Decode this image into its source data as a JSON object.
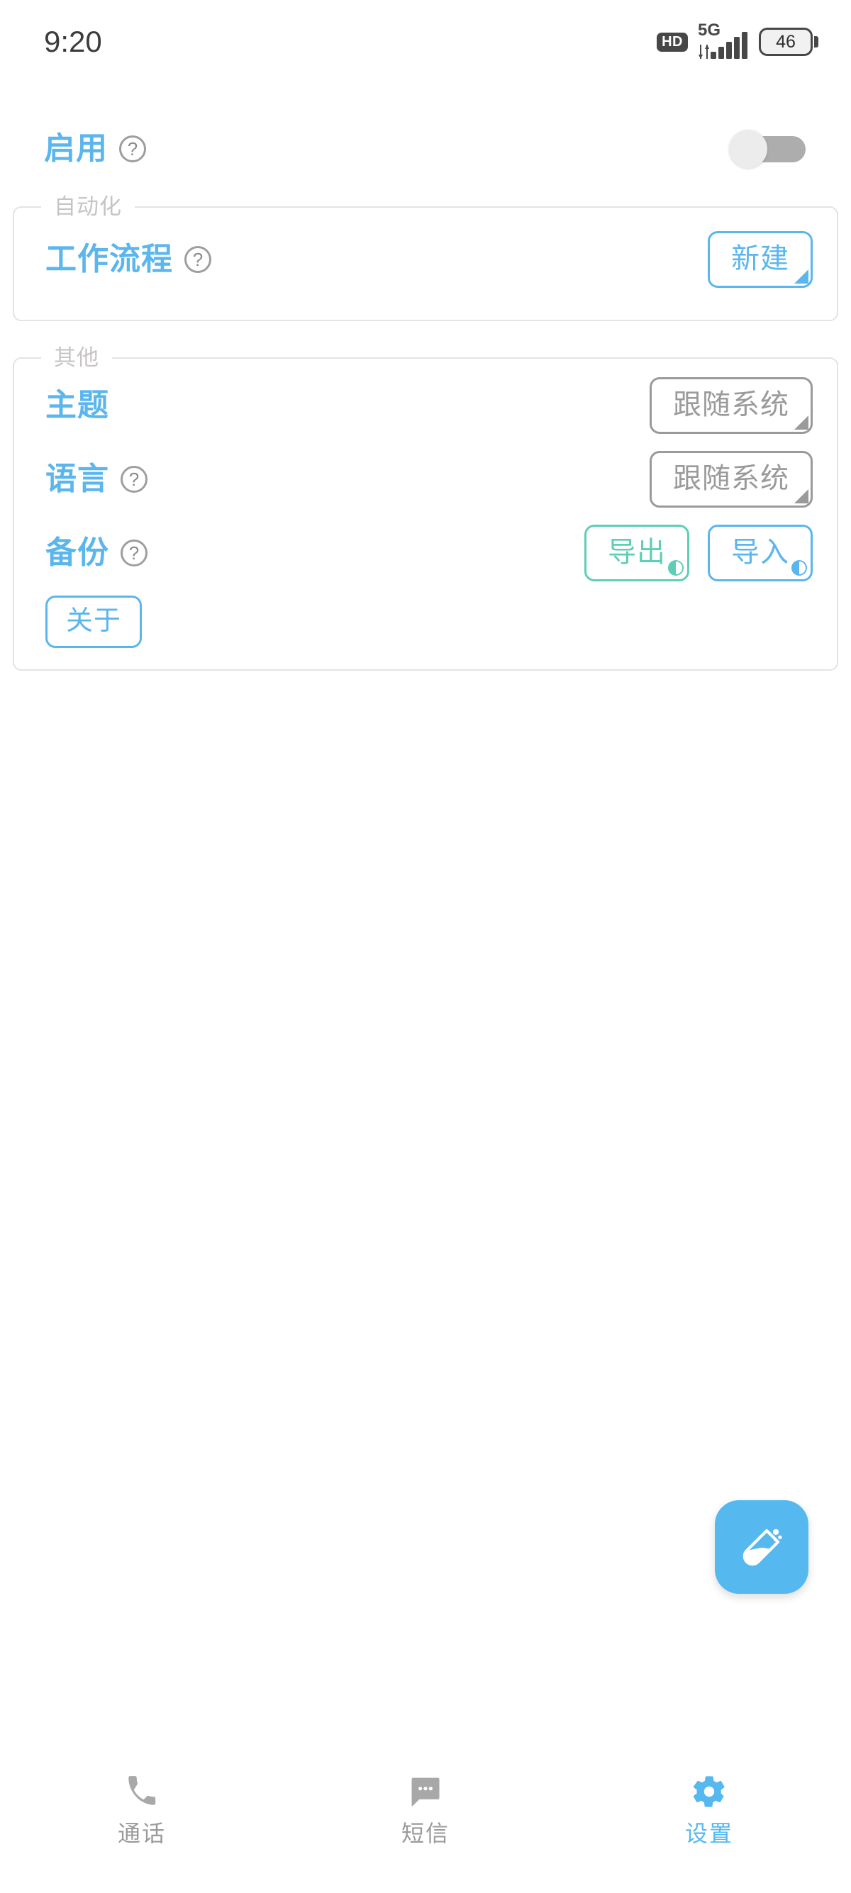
{
  "status_bar": {
    "time": "9:20",
    "hd_label": "HD",
    "network_label": "5G",
    "signal_bars": 5,
    "battery_percent": "46"
  },
  "enable_section": {
    "label": "启用",
    "help_icon": "help-circle-icon",
    "help_glyph": "?",
    "toggle_state": "off"
  },
  "automation_group": {
    "legend": "自动化",
    "workflow": {
      "label": "工作流程",
      "help_icon": "help-circle-icon",
      "help_glyph": "?",
      "action_label": "新建"
    }
  },
  "other_group": {
    "legend": "其他",
    "theme": {
      "label": "主题",
      "value": "跟随系统"
    },
    "language": {
      "label": "语言",
      "help_icon": "help-circle-icon",
      "help_glyph": "?",
      "value": "跟随系统"
    },
    "backup": {
      "label": "备份",
      "help_icon": "help-circle-icon",
      "help_glyph": "?",
      "export_label": "导出",
      "import_label": "导入"
    },
    "about_label": "关于"
  },
  "fab": {
    "icon": "test-tube-icon"
  },
  "bottom_nav": {
    "items": [
      {
        "label": "通话",
        "icon": "phone-icon",
        "active": false
      },
      {
        "label": "短信",
        "icon": "message-icon",
        "active": false
      },
      {
        "label": "设置",
        "icon": "gear-icon",
        "active": true
      }
    ]
  },
  "colors": {
    "accent_blue": "#5bb6ee",
    "accent_teal": "#5ecfb4",
    "muted_gray": "#9a9a9a",
    "legend_gray": "#c7c4c4",
    "border_gray": "#e3e3e3"
  }
}
